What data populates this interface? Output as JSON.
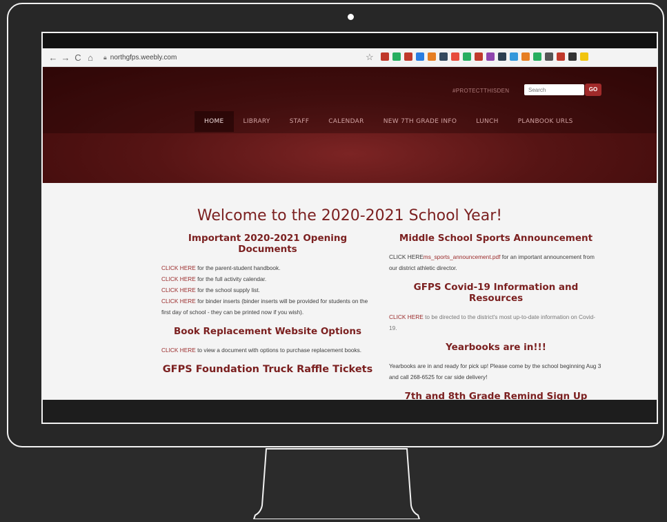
{
  "browser": {
    "url": "northgfps.weebly.com",
    "extension_colors": [
      "#c0392b",
      "#27ae60",
      "#c0392b",
      "#2a7de1",
      "#e67e22",
      "#34495e",
      "#e74c3c",
      "#27ae60",
      "#c0392b",
      "#8e44ad",
      "#2c3e50",
      "#3498db",
      "#e67e22",
      "#27ae60",
      "#555555",
      "#c0392b",
      "#333333",
      "#f1c40f"
    ]
  },
  "site": {
    "tagline": "#PROTECTTHISDEN",
    "search_placeholder": "Search",
    "go_label": "GO",
    "nav": [
      "HOME",
      "LIBRARY",
      "STAFF",
      "CALENDAR",
      "NEW 7TH GRADE INFO",
      "LUNCH",
      "PLANBOOK URLS"
    ],
    "page_title": "Welcome to the 2020-2021 School Year!",
    "left": {
      "opening_heading": "Important 2020-2021 Opening Documents",
      "links": [
        {
          "link": "CLICK HERE",
          "text": " for the parent-student handbook."
        },
        {
          "link": "CLICK HERE",
          "text": " for the full activity calendar."
        },
        {
          "link": "CLICK HERE",
          "text": " for the school supply list."
        },
        {
          "link": "CLICK HERE",
          "text": " for binder inserts (binder inserts will be provided for students on the first day of school - they can be printed now if you wish)."
        }
      ],
      "book_heading": "Book Replacement Website Options",
      "book_link": "CLICK HERE",
      "book_text": " to view a document with options to purchase replacement books.",
      "raffle_heading": "GFPS Foundation Truck Raffle Tickets"
    },
    "right": {
      "sports_heading": "Middle School Sports Announcement",
      "sports_prefix": "CLICK HERE",
      "sports_link": "ms_sports_announcement.pdf",
      "sports_text": " for an important announcement from our district athletic director.",
      "covid_heading": "GFPS Covid-19 Information and Resources",
      "covid_link": "CLICK HERE",
      "covid_text": " to be directed to the district's most up-to-date information on Covid-19.",
      "yearbook_heading": "Yearbooks are in!!!",
      "yearbook_text": "Yearbooks are in and ready for pick up! Please come by the school beginning Aug 3 and call 268-6525 for car side delivery!",
      "remind_heading": "7th and 8th Grade Remind Sign Up"
    }
  }
}
